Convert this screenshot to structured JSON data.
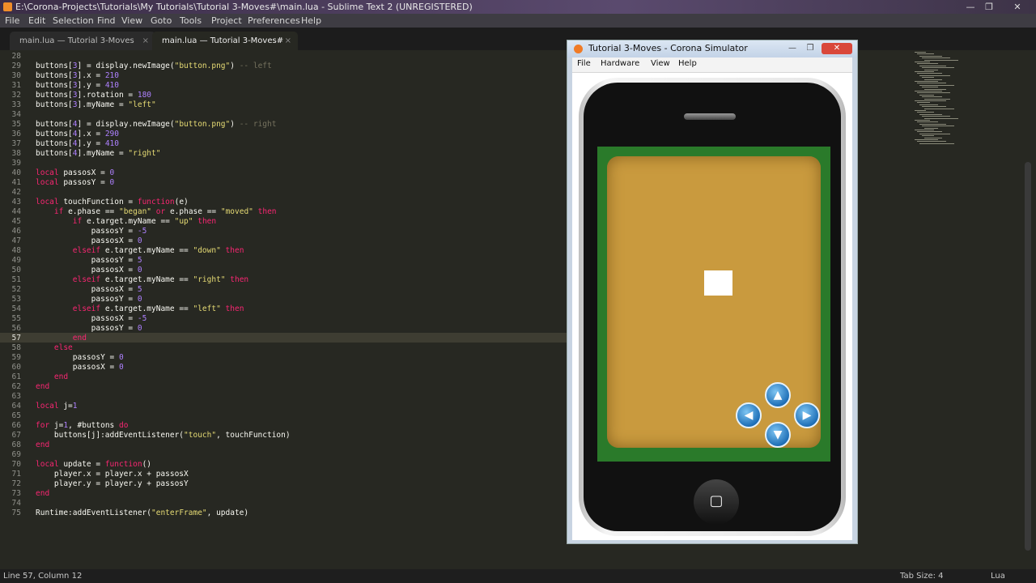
{
  "window": {
    "title": "E:\\Corona-Projects\\Tutorials\\My Tutorials\\Tutorial 3-Moves#\\main.lua - Sublime Text 2 (UNREGISTERED)",
    "min": "—",
    "max": "❐",
    "close": "✕"
  },
  "menu": [
    "File",
    "Edit",
    "Selection",
    "Find",
    "View",
    "Goto",
    "Tools",
    "Project",
    "Preferences",
    "Help"
  ],
  "tabs": [
    {
      "label": "main.lua — Tutorial 3-Moves",
      "close": "×"
    },
    {
      "label": "main.lua — Tutorial 3-Moves#",
      "close": "×"
    }
  ],
  "code": {
    "line_numbers": [
      "28",
      "29",
      "30",
      "31",
      "32",
      "33",
      "34",
      "35",
      "36",
      "37",
      "38",
      "39",
      "40",
      "41",
      "42",
      "43",
      "44",
      "45",
      "46",
      "47",
      "48",
      "49",
      "50",
      "51",
      "52",
      "53",
      "54",
      "55",
      "56",
      "57",
      "58",
      "59",
      "60",
      "61",
      "62",
      "63",
      "64",
      "65",
      "66",
      "67",
      "68",
      "69",
      "70",
      "71",
      "72",
      "73",
      "74",
      "75"
    ],
    "current_line": "57"
  },
  "simulator": {
    "title": "Tutorial 3-Moves - Corona Simulator",
    "menu": [
      "File",
      "Hardware",
      "View",
      "Help"
    ],
    "buttons": {
      "up": "▲",
      "left": "◀",
      "right": "▶",
      "down": "▼"
    },
    "home": "▢"
  },
  "status": {
    "position": "Line 57, Column 12",
    "tab_size": "Tab Size: 4",
    "syntax": "Lua"
  }
}
